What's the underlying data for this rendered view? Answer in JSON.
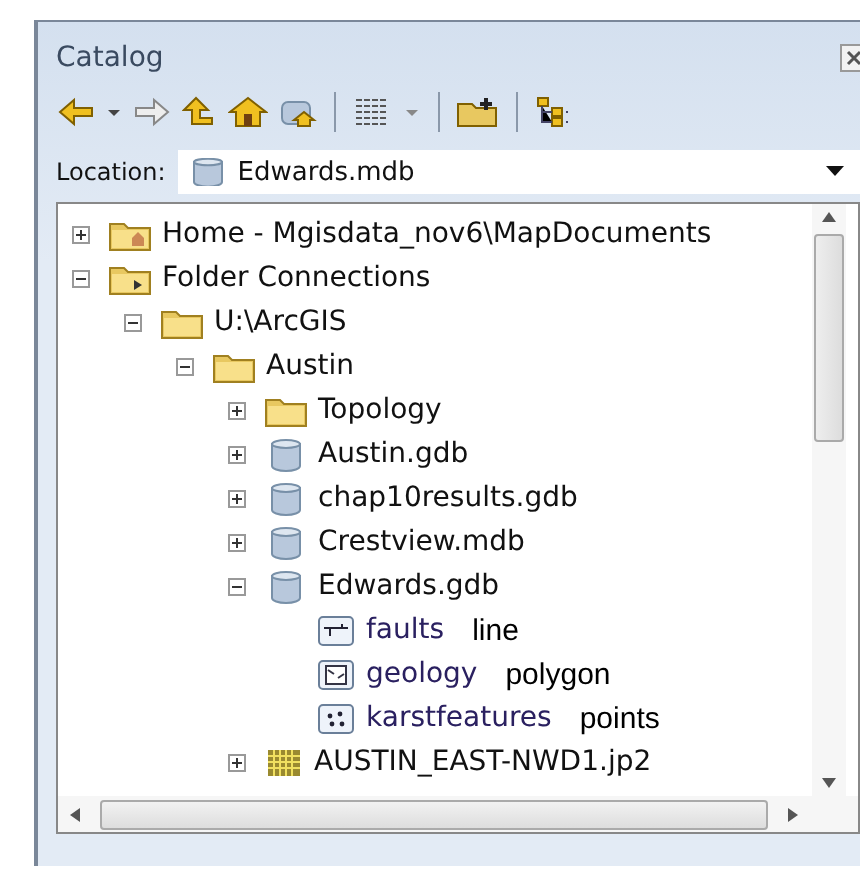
{
  "window": {
    "title": "Catalog"
  },
  "location": {
    "label": "Location:",
    "value": "Edwards.mdb"
  },
  "tree": [
    {
      "label": "Home - Mgisdata_nov6\\MapDocuments",
      "kind": "home-folder",
      "expanded": false
    },
    {
      "label": "Folder Connections",
      "kind": "connections-folder",
      "expanded": true,
      "children": [
        {
          "label": "U:\\ArcGIS",
          "kind": "connection",
          "expanded": true,
          "children": [
            {
              "label": "Austin",
              "kind": "folder",
              "expanded": true,
              "children": [
                {
                  "label": "Topology",
                  "kind": "folder",
                  "expanded": false
                },
                {
                  "label": "Austin.gdb",
                  "kind": "database",
                  "expanded": false
                },
                {
                  "label": "chap10results.gdb",
                  "kind": "database",
                  "expanded": false
                },
                {
                  "label": "Crestview.mdb",
                  "kind": "database",
                  "expanded": false
                },
                {
                  "label": " Edwards.gdb",
                  "kind": "database",
                  "expanded": true,
                  "children": [
                    {
                      "label": "faults",
                      "kind": "line",
                      "note": "line"
                    },
                    {
                      "label": "geology",
                      "kind": "polygon",
                      "note": "polygon"
                    },
                    {
                      "label": "karstfeatures",
                      "kind": "point",
                      "note": "points"
                    }
                  ]
                },
                {
                  "label": "AUSTIN_EAST-NWD1.jp2",
                  "kind": "raster",
                  "expanded": false
                }
              ]
            }
          ]
        }
      ]
    }
  ]
}
